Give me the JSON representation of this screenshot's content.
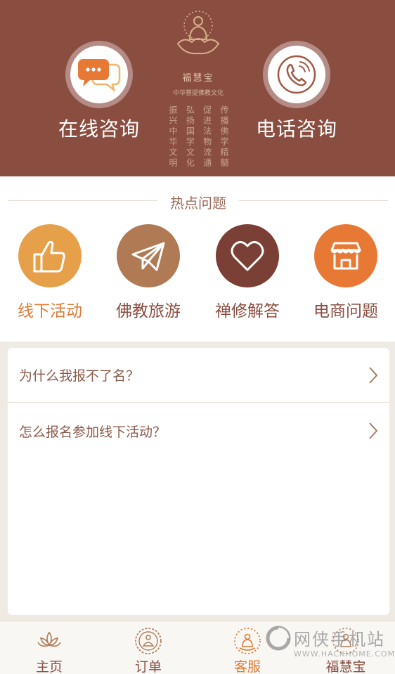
{
  "header": {
    "online_label": "在线咨询",
    "phone_label": "电话咨询",
    "brand_name": "福慧宝",
    "brand_sub": "中华菩提佛教文化",
    "poem": [
      "传播佛学精髓",
      "促进法物流通",
      "弘扬国学文化",
      "振兴中华文明"
    ]
  },
  "hot": {
    "title": "热点问题",
    "categories": [
      {
        "label": "线下活动",
        "icon": "thumbs-up-icon",
        "color": "#e6a04a"
      },
      {
        "label": "佛教旅游",
        "icon": "paper-plane-icon",
        "color": "#b07a55"
      },
      {
        "label": "禅修解答",
        "icon": "heart-icon",
        "color": "#7a3f35"
      },
      {
        "label": "电商问题",
        "icon": "shop-icon",
        "color": "#e87935"
      }
    ]
  },
  "questions": [
    {
      "text": "为什么我报不了名？"
    },
    {
      "text": "怎么报名参加线下活动？"
    }
  ],
  "nav": {
    "items": [
      {
        "label": "主页"
      },
      {
        "label": "订单"
      },
      {
        "label": "客服"
      },
      {
        "label": "福慧宝"
      }
    ]
  },
  "watermark": {
    "big": "网侠手机站",
    "small": "WWW.HACKHOME.COM"
  },
  "colors": {
    "header_bg": "#8a4e41",
    "accent": "#e07a34"
  }
}
